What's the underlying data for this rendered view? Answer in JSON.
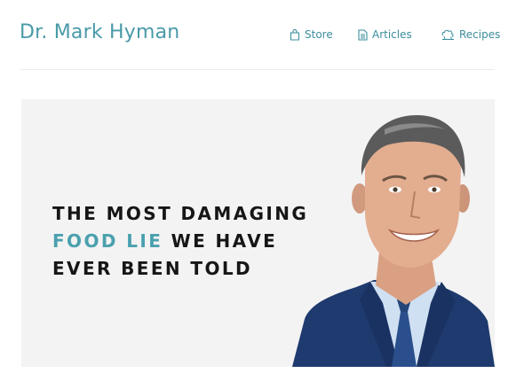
{
  "header": {
    "logo": "Dr. Mark Hyman",
    "nav": [
      {
        "label": "Store",
        "icon": "shopping-bag-icon"
      },
      {
        "label": "Articles",
        "icon": "document-icon"
      },
      {
        "label": "Recipes",
        "icon": "chef-hat-icon"
      }
    ]
  },
  "hero": {
    "headline_line1": "THE MOST DAMAGING",
    "headline_line2_accent": "FOOD LIE",
    "headline_line2_rest": " WE HAVE",
    "headline_line3": "EVER BEEN TOLD",
    "photo": "portrait-photo"
  },
  "colors": {
    "accent": "#4aa0ae",
    "hero_background": "#f3f3f3",
    "headline": "#161616"
  }
}
